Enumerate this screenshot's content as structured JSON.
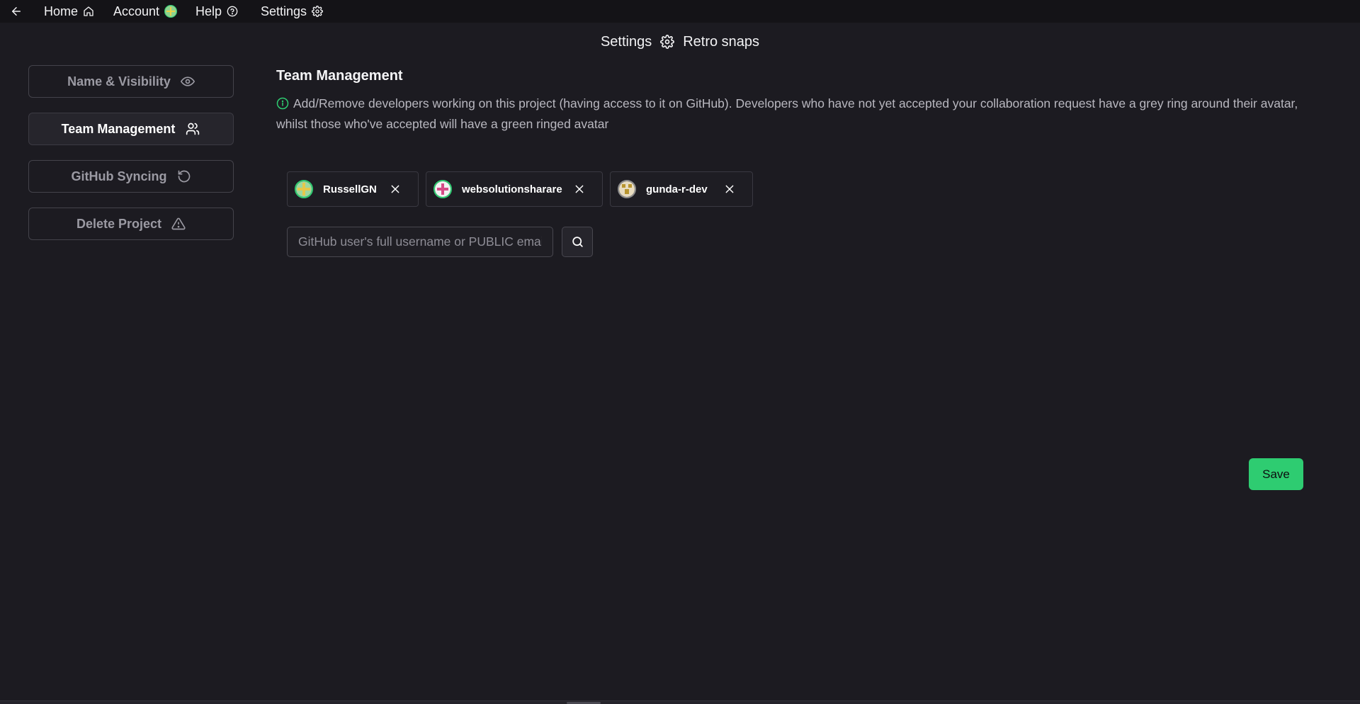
{
  "nav": {
    "back_icon": "arrow-left-icon",
    "home_label": "Home",
    "home_icon": "home-icon",
    "account_label": "Account",
    "help_label": "Help",
    "help_icon": "help-circle-icon",
    "settings_label": "Settings",
    "settings_icon": "gear-icon"
  },
  "header": {
    "settings_label": "Settings",
    "project_name": "Retro snaps"
  },
  "sidebar": {
    "items": [
      {
        "label": "Name & Visibility",
        "icon": "eye-icon",
        "active": false
      },
      {
        "label": "Team Management",
        "icon": "users-icon",
        "active": true
      },
      {
        "label": "GitHub Syncing",
        "icon": "refresh-icon",
        "active": false
      },
      {
        "label": "Delete Project",
        "icon": "warning-icon",
        "active": false
      }
    ]
  },
  "main": {
    "title": "Team Management",
    "info": "Add/Remove developers working on this project (having access to it on GitHub). Developers who have not yet accepted your collaboration request have a grey ring around their avatar, whilst those who've accepted will have a green ringed avatar",
    "members": [
      {
        "username": "RussellGN",
        "ring": "green"
      },
      {
        "username": "websolutionsharare",
        "ring": "green"
      },
      {
        "username": "gunda-r-dev",
        "ring": "grey"
      }
    ],
    "search_placeholder": "GitHub user's full username or PUBLIC email",
    "search_icon": "search-icon",
    "save_label": "Save"
  },
  "colors": {
    "background": "#1c1b21",
    "accent": "#2ecc71",
    "pending_ring": "#8c8c8c"
  }
}
